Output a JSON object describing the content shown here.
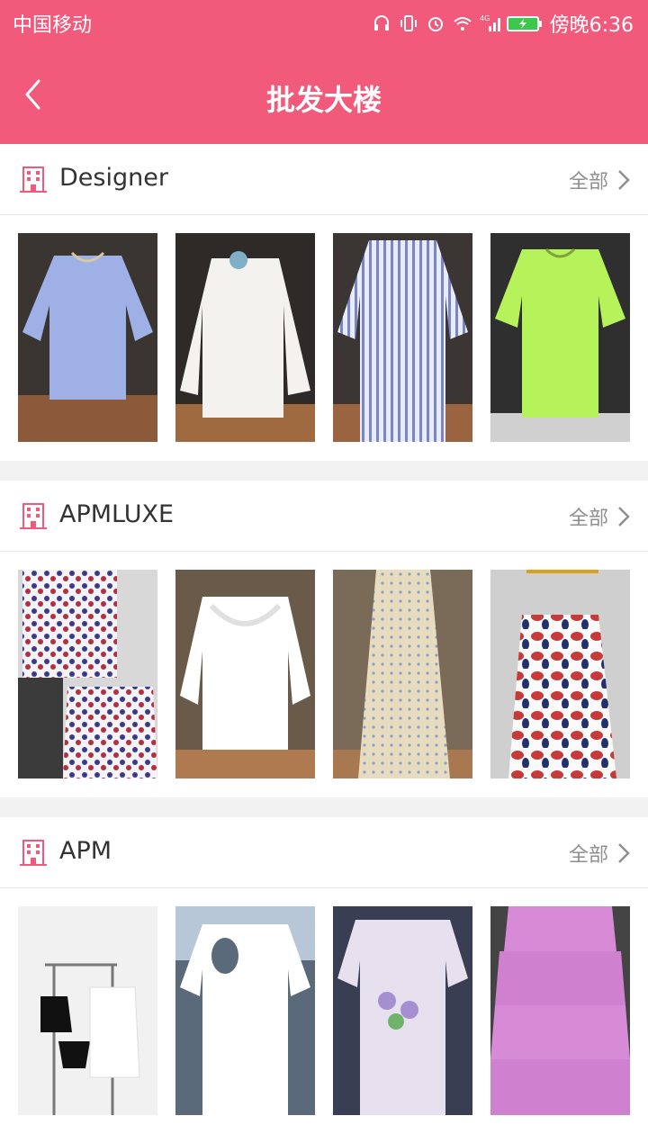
{
  "status": {
    "carrier": "中国移动",
    "time": "傍晚6:36",
    "network": "4G"
  },
  "header": {
    "title": "批发大楼"
  },
  "sections": [
    {
      "name": "Designer",
      "all_label": "全部",
      "items": [
        {
          "icon": "blue-blouse",
          "color": "#9fb0e6"
        },
        {
          "icon": "white-shirt",
          "color": "#f4f2ee"
        },
        {
          "icon": "striped-shirt",
          "color": "#c9cde6"
        },
        {
          "icon": "lime-tshirt",
          "color": "#b6f25a"
        }
      ]
    },
    {
      "name": "APMLUXE",
      "all_label": "全部",
      "items": [
        {
          "icon": "print-top-set",
          "color": "#5a5aa8"
        },
        {
          "icon": "white-ruffle-top",
          "color": "#ffffff"
        },
        {
          "icon": "floral-maxi-dress",
          "color": "#e8dcc0"
        },
        {
          "icon": "red-floral-dress",
          "color": "#c63a3a"
        }
      ]
    },
    {
      "name": "APM",
      "all_label": "全部",
      "items": [
        {
          "icon": "swimsuit-rack",
          "color": "#111111"
        },
        {
          "icon": "white-cutout-tee",
          "color": "#ffffff"
        },
        {
          "icon": "lavender-print-tee",
          "color": "#e7e0ef"
        },
        {
          "icon": "pink-tiered-skirt",
          "color": "#d78ad6"
        }
      ]
    }
  ],
  "theme": {
    "accent": "#f25a7c"
  }
}
